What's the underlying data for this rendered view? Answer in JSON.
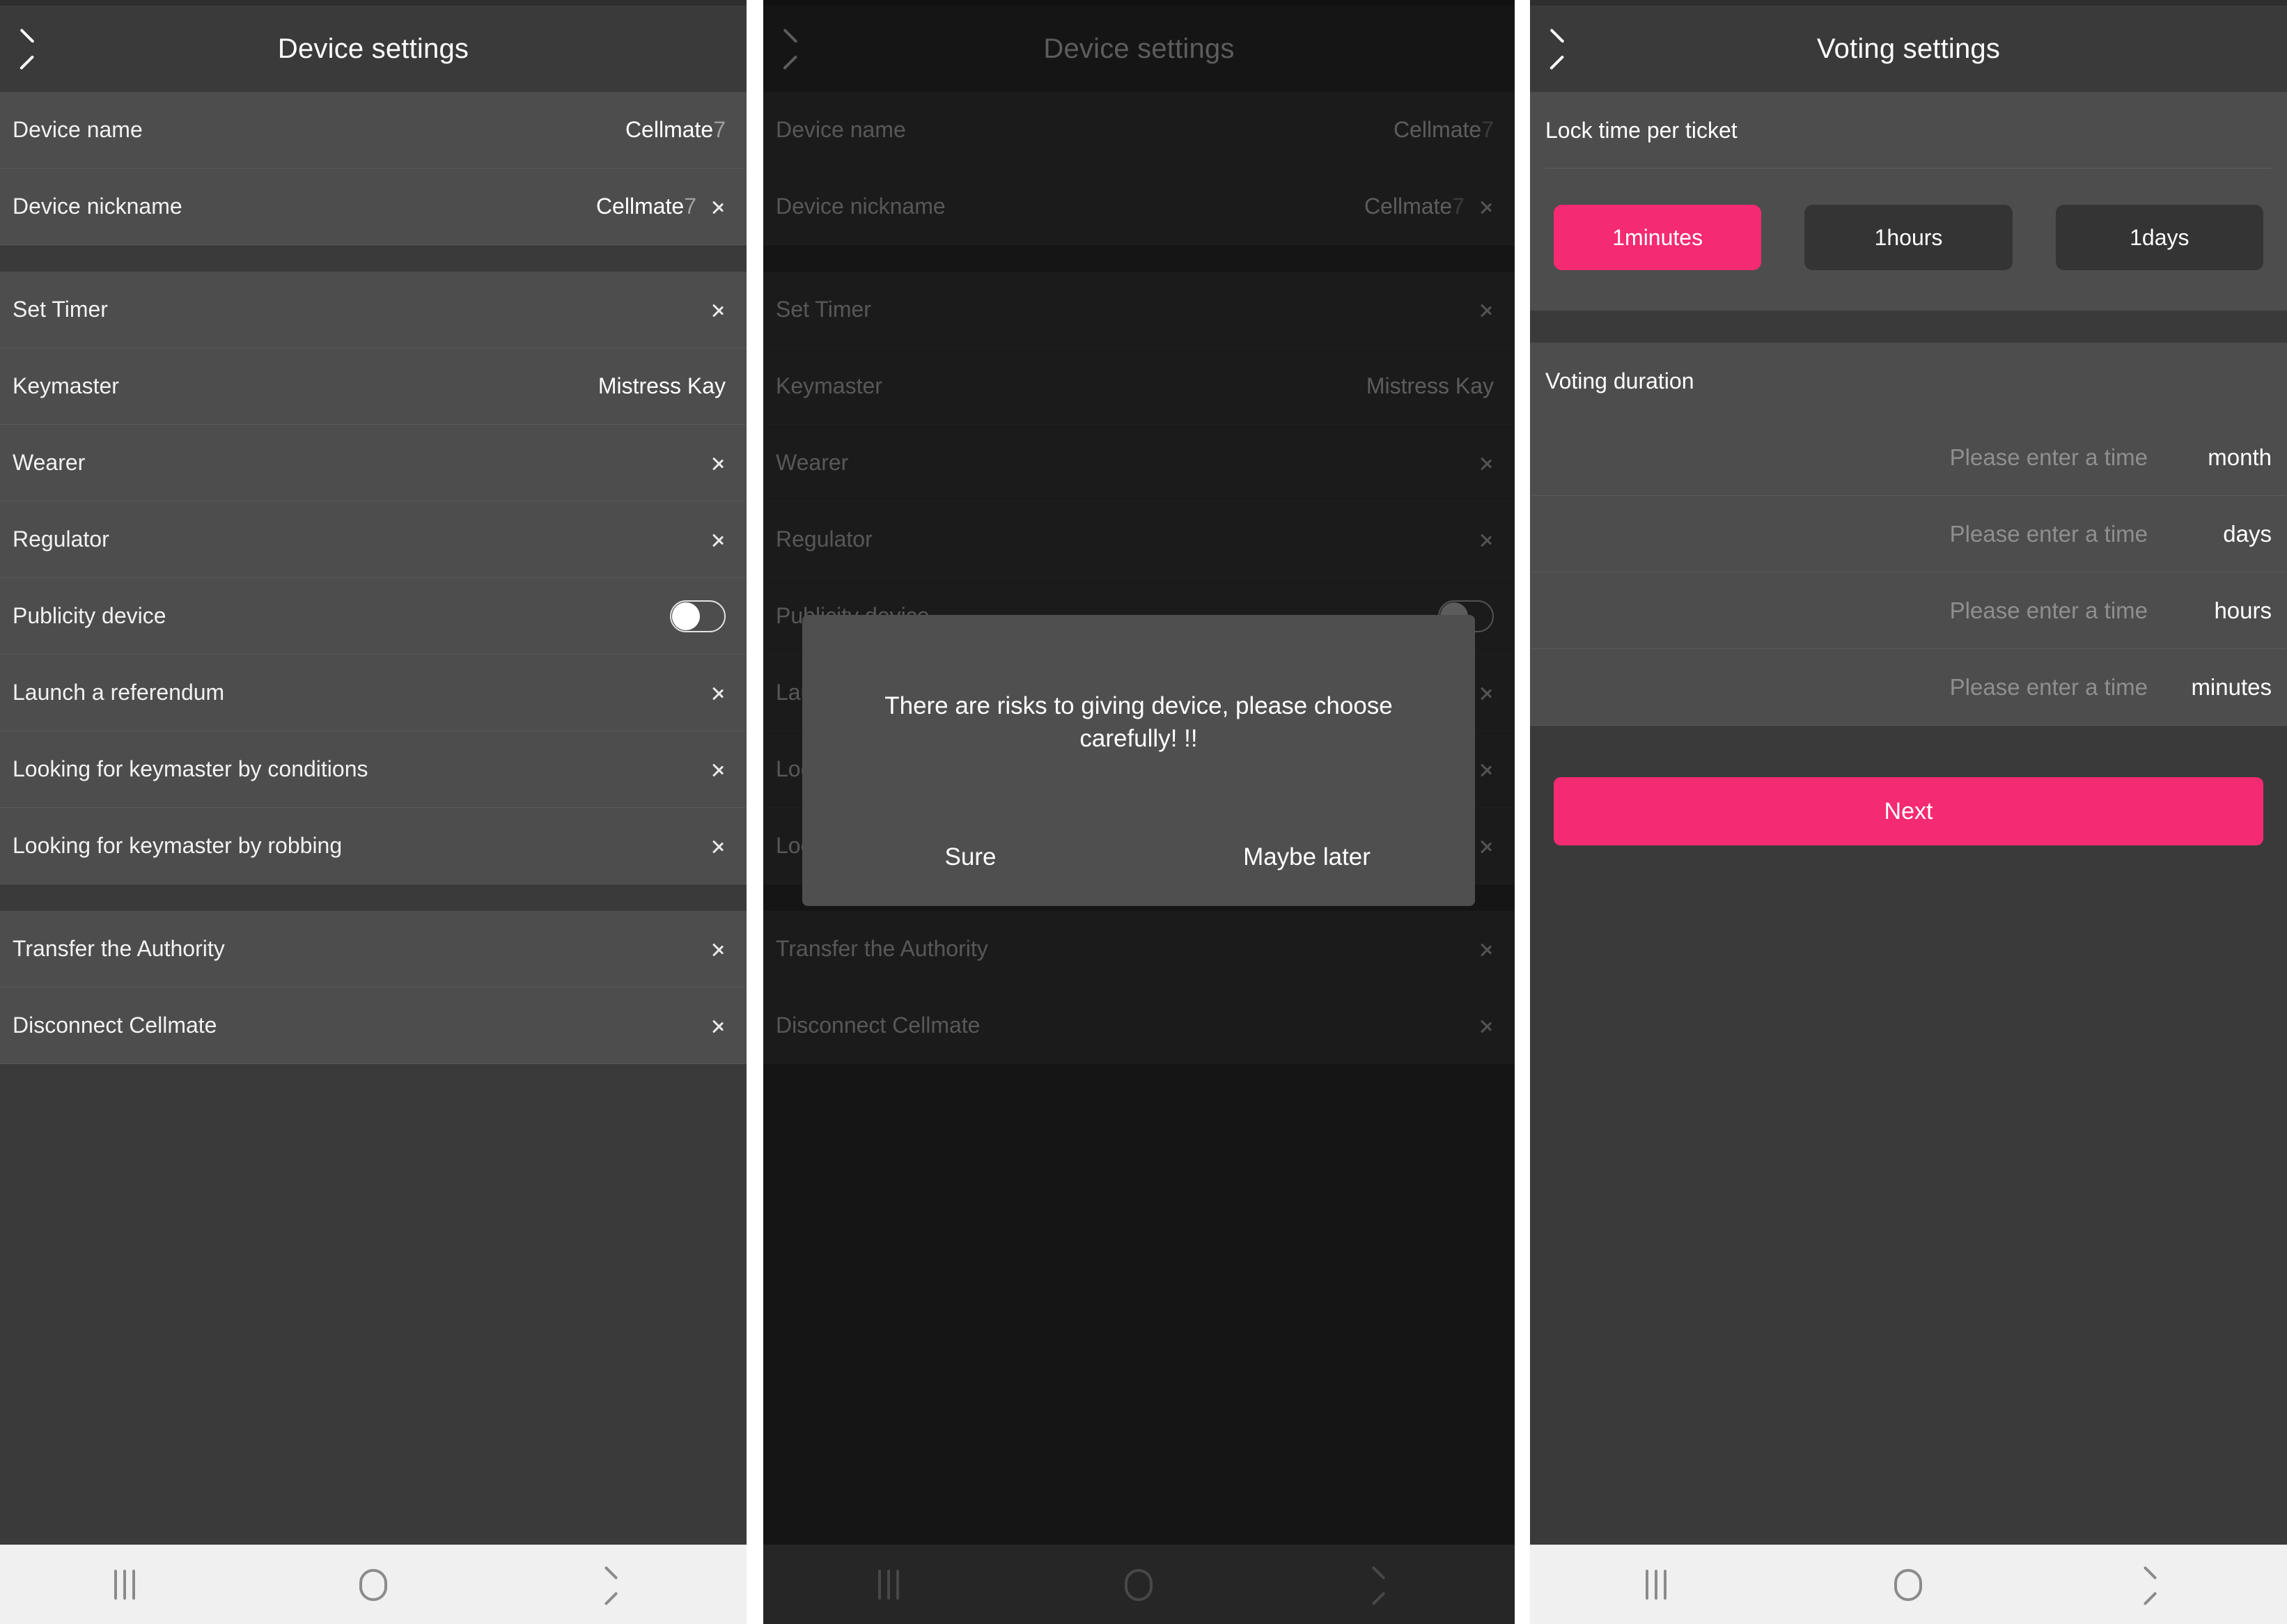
{
  "theme": {
    "accent": "#f42a72",
    "header_bg": "#3a3a3a",
    "row_bg": "#4d4d4d",
    "section_bg": "#3a3a3a",
    "dialog_bg": "#4f4f4f",
    "text": "#ffffff",
    "placeholder": "#8f8f8f"
  },
  "screen1": {
    "header": {
      "title": "Device settings",
      "back_icon": "chevron-left-icon"
    },
    "rows": [
      {
        "label": "Device name",
        "value": "Cellmate",
        "value_dim": "7",
        "chevron": false,
        "toggle": null
      },
      {
        "label": "Device nickname",
        "value": "Cellmate",
        "value_dim": "7",
        "chevron": true,
        "toggle": null
      },
      {
        "label": "Set Timer",
        "value": "",
        "value_dim": "",
        "chevron": true,
        "toggle": null
      },
      {
        "label": "Keymaster",
        "value": "Mistress Kay",
        "value_dim": "",
        "chevron": false,
        "toggle": null
      },
      {
        "label": "Wearer",
        "value": "",
        "value_dim": "",
        "chevron": true,
        "toggle": null
      },
      {
        "label": "Regulator",
        "value": "",
        "value_dim": "",
        "chevron": true,
        "toggle": null
      },
      {
        "label": "Publicity device",
        "value": "",
        "value_dim": "",
        "chevron": false,
        "toggle": "off"
      },
      {
        "label": "Launch a referendum",
        "value": "",
        "value_dim": "",
        "chevron": true,
        "toggle": null
      },
      {
        "label": "Looking for keymaster by conditions",
        "value": "",
        "value_dim": "",
        "chevron": true,
        "toggle": null
      },
      {
        "label": "Looking for keymaster by robbing",
        "value": "",
        "value_dim": "",
        "chevron": true,
        "toggle": null
      },
      {
        "label": "Transfer the Authority",
        "value": "",
        "value_dim": "",
        "chevron": true,
        "toggle": null
      },
      {
        "label": "Disconnect Cellmate",
        "value": "",
        "value_dim": "",
        "chevron": true,
        "toggle": null
      }
    ]
  },
  "screen2": {
    "header": {
      "title": "Device settings",
      "back_icon": "chevron-left-icon"
    },
    "dialog": {
      "message": "There are risks to giving device, please choose carefully! !!",
      "confirm_label": "Sure",
      "dismiss_label": "Maybe later"
    }
  },
  "screen3": {
    "header": {
      "title": "Voting settings",
      "back_icon": "chevron-left-icon"
    },
    "lock_time": {
      "section_label": "Lock time per ticket",
      "options": [
        {
          "label": "1minutes",
          "selected": true
        },
        {
          "label": "1hours",
          "selected": false
        },
        {
          "label": "1days",
          "selected": false
        }
      ]
    },
    "voting_duration": {
      "section_label": "Voting duration",
      "fields": [
        {
          "placeholder": "Please enter a time",
          "value": "",
          "unit": "month"
        },
        {
          "placeholder": "Please enter a time",
          "value": "",
          "unit": "days"
        },
        {
          "placeholder": "Please enter a time",
          "value": "",
          "unit": "hours"
        },
        {
          "placeholder": "Please enter a time",
          "value": "",
          "unit": "minutes"
        }
      ]
    },
    "next_label": "Next"
  },
  "navbar": {
    "recents_icon": "recents-icon",
    "home_icon": "home-icon",
    "back_icon": "back-icon"
  }
}
